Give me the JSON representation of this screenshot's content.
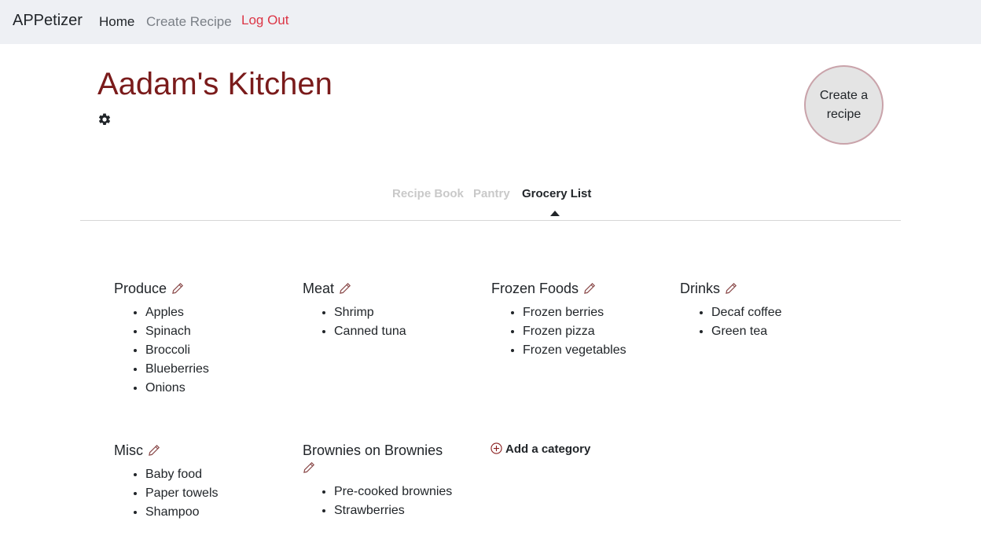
{
  "navbar": {
    "brand": "APPetizer",
    "links": {
      "home": "Home",
      "create_recipe": "Create Recipe",
      "log_out": "Log Out"
    }
  },
  "header": {
    "title": "Aadam's Kitchen",
    "create_button_label": "Create a recipe"
  },
  "tabs": {
    "recipe_book": "Recipe Book",
    "pantry": "Pantry",
    "grocery_list": "Grocery List",
    "active": "Grocery List"
  },
  "categories": [
    {
      "name": "Produce",
      "items": [
        "Apples",
        "Spinach",
        "Broccoli",
        "Blueberries",
        "Onions"
      ]
    },
    {
      "name": "Meat",
      "items": [
        "Shrimp",
        "Canned tuna"
      ]
    },
    {
      "name": "Frozen Foods",
      "items": [
        "Frozen berries",
        "Frozen pizza",
        "Frozen vegetables"
      ]
    },
    {
      "name": "Drinks",
      "items": [
        "Decaf coffee",
        "Green tea"
      ]
    },
    {
      "name": "Misc",
      "items": [
        "Baby food",
        "Paper towels",
        "Shampoo"
      ]
    },
    {
      "name": "Brownies on Brownies",
      "items": [
        "Pre-cooked brownies",
        "Strawberries"
      ]
    }
  ],
  "add_category_label": "Add a category",
  "icons": {
    "settings": "gear-icon",
    "edit": "pencil-icon",
    "add": "plus-circle-icon"
  },
  "colors": {
    "title": "#7a1b1b",
    "logout": "#dc3545",
    "edit_icon": "#8a4a4a",
    "navbar_bg": "#eef0f4"
  }
}
